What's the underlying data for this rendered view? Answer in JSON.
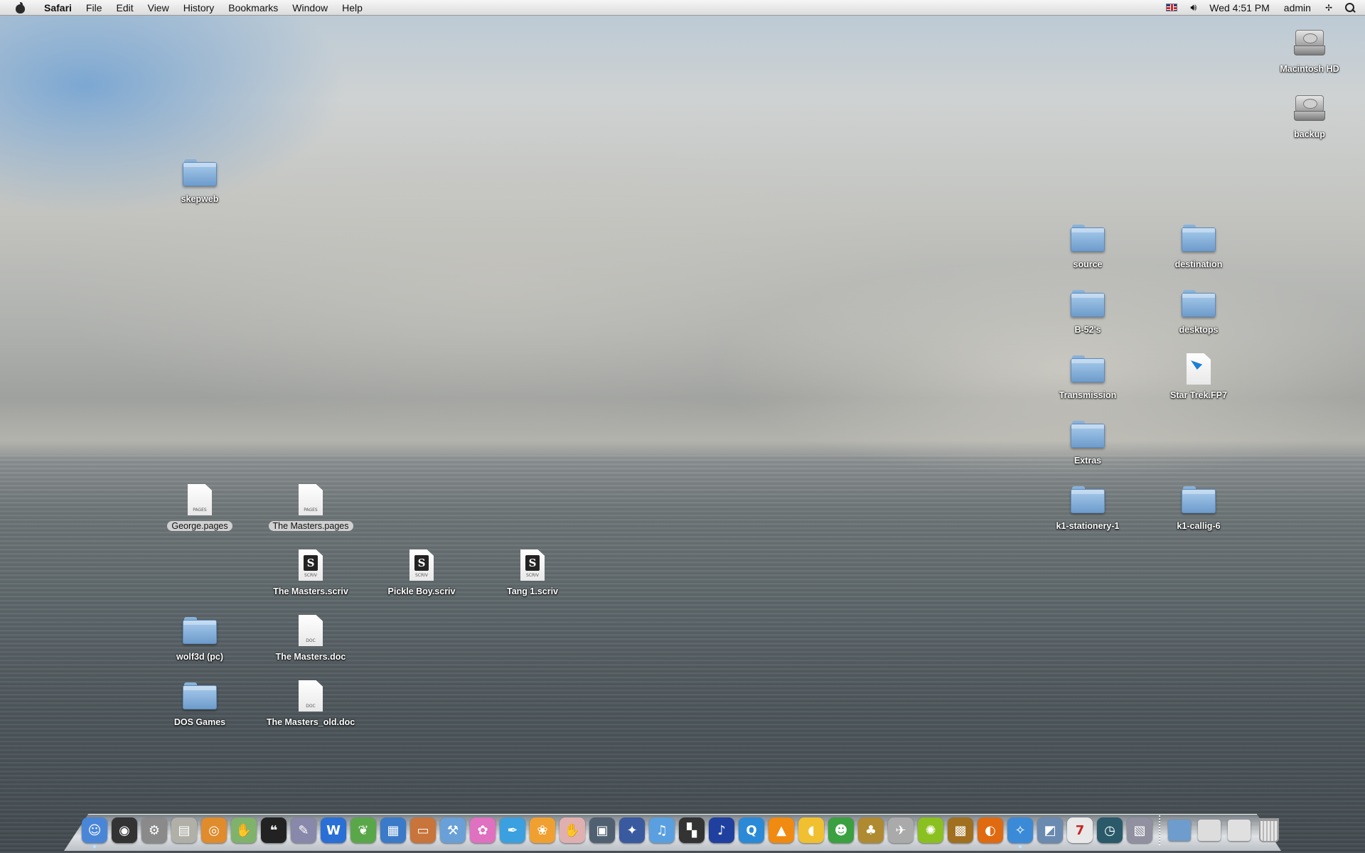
{
  "menubar": {
    "app_name": "Safari",
    "menus": [
      "File",
      "Edit",
      "View",
      "History",
      "Bookmarks",
      "Window",
      "Help"
    ],
    "clock": "Wed 4:51 PM",
    "user": "admin"
  },
  "desktop": {
    "drives": [
      "Macintosh HD",
      "backup"
    ],
    "icons": {
      "skepweb": "skepweb",
      "source": "source",
      "destination": "destination",
      "b52s": "B-52's",
      "desktops": "desktops",
      "transmission": "Transmission",
      "startrek": "Star Trek.FP7",
      "extras": "Extras",
      "k1_stationery": "k1-stationery-1",
      "k1_callig": "k1-callig-6",
      "george_pages": "George.pages",
      "masters_pages": "The Masters.pages",
      "masters_scriv": "The Masters.scriv",
      "pickle_scriv": "Pickle Boy.scriv",
      "tang_scriv": "Tang 1.scriv",
      "wolf3d": "wolf3d (pc)",
      "masters_doc": "The Masters.doc",
      "dos_games": "DOS Games",
      "masters_old_doc": "The Masters_old.doc"
    },
    "file_tags": {
      "pages": "PAGES",
      "scriv": "SCRIV",
      "doc": "DOC"
    }
  },
  "dock": {
    "apps": [
      {
        "icon": "finder-icon",
        "color": "#4a86d8",
        "glyph": "☺",
        "running": true
      },
      {
        "icon": "dashboard-icon",
        "color": "#333333",
        "glyph": "◉",
        "running": false
      },
      {
        "icon": "system-preferences-icon",
        "color": "#8a8a8a",
        "glyph": "⚙",
        "running": false
      },
      {
        "icon": "preview-icon",
        "color": "#b0b0a8",
        "glyph": "▤",
        "running": false
      },
      {
        "icon": "blender-icon",
        "color": "#e08b2c",
        "glyph": "◎",
        "running": false
      },
      {
        "icon": "hand-app-icon",
        "color": "#7fb36c",
        "glyph": "✋",
        "running": false
      },
      {
        "icon": "quote-app-icon",
        "color": "#222222",
        "glyph": "❝",
        "running": false
      },
      {
        "icon": "script-editor-icon",
        "color": "#8888aa",
        "glyph": "✎",
        "running": false
      },
      {
        "icon": "textwrangler-icon",
        "color": "#2a6fd6",
        "glyph": "W",
        "running": false
      },
      {
        "icon": "plant-app-icon",
        "color": "#5aa74a",
        "glyph": "❦",
        "running": false
      },
      {
        "icon": "grapher-icon",
        "color": "#3a7ac8",
        "glyph": "▦",
        "running": false
      },
      {
        "icon": "keynote-icon",
        "color": "#c8743a",
        "glyph": "▭",
        "running": false
      },
      {
        "icon": "xcode-icon",
        "color": "#6aa0d8",
        "glyph": "⚒",
        "running": false
      },
      {
        "icon": "flower-app-icon",
        "color": "#e070c0",
        "glyph": "✿",
        "running": false
      },
      {
        "icon": "pen-app-icon",
        "color": "#3aa0e0",
        "glyph": "✒",
        "running": false
      },
      {
        "icon": "iphoto-flower-icon",
        "color": "#f0a030",
        "glyph": "❀",
        "running": false
      },
      {
        "icon": "glove-app-icon",
        "color": "#e0b0b0",
        "glyph": "✋",
        "running": false
      },
      {
        "icon": "iphoto-icon",
        "color": "#506070",
        "glyph": "▣",
        "running": false
      },
      {
        "icon": "imovie-icon",
        "color": "#3a5aa0",
        "glyph": "✦",
        "running": false
      },
      {
        "icon": "itunes-icon",
        "color": "#5aa0e0",
        "glyph": "♫",
        "running": false
      },
      {
        "icon": "clapper-app-icon",
        "color": "#333333",
        "glyph": "▚",
        "running": false
      },
      {
        "icon": "garageband-icon",
        "color": "#2040a0",
        "glyph": "♪",
        "running": false
      },
      {
        "icon": "quicktime-icon",
        "color": "#2a8ad8",
        "glyph": "Q",
        "running": false
      },
      {
        "icon": "vlc-icon",
        "color": "#f08a10",
        "glyph": "▲",
        "running": false
      },
      {
        "icon": "cyberduck-icon",
        "color": "#f0c030",
        "glyph": "◖",
        "running": false
      },
      {
        "icon": "adium-icon",
        "color": "#3aa040",
        "glyph": "☻",
        "running": false
      },
      {
        "icon": "pineapple-app-icon",
        "color": "#b08a30",
        "glyph": "♣",
        "running": false
      },
      {
        "icon": "mail-app-icon",
        "color": "#aaaaaa",
        "glyph": "✈",
        "running": false
      },
      {
        "icon": "lime-app-icon",
        "color": "#8ac020",
        "glyph": "✺",
        "running": false
      },
      {
        "icon": "dosbox-icon",
        "color": "#a07020",
        "glyph": "▩",
        "running": false
      },
      {
        "icon": "firefox-icon",
        "color": "#e06a10",
        "glyph": "◐",
        "running": false
      },
      {
        "icon": "safari-icon",
        "color": "#3a8ad8",
        "glyph": "✧",
        "running": true
      },
      {
        "icon": "photo-frame-icon",
        "color": "#6a8ab0",
        "glyph": "◩",
        "running": false
      },
      {
        "icon": "ical-icon",
        "color": "#e8e8e8",
        "glyph": "7",
        "running": false
      },
      {
        "icon": "time-machine-icon",
        "color": "#2a5a6a",
        "glyph": "◷",
        "running": false
      },
      {
        "icon": "image-capture-icon",
        "color": "#9090a0",
        "glyph": "▧",
        "running": false
      }
    ],
    "stacks": [
      {
        "icon": "applications-stack-icon",
        "color": "#6e9ccc"
      },
      {
        "icon": "documents-stack-icon",
        "color": "#dddddd"
      },
      {
        "icon": "downloads-stack-icon",
        "color": "#e0e0e0"
      }
    ]
  }
}
